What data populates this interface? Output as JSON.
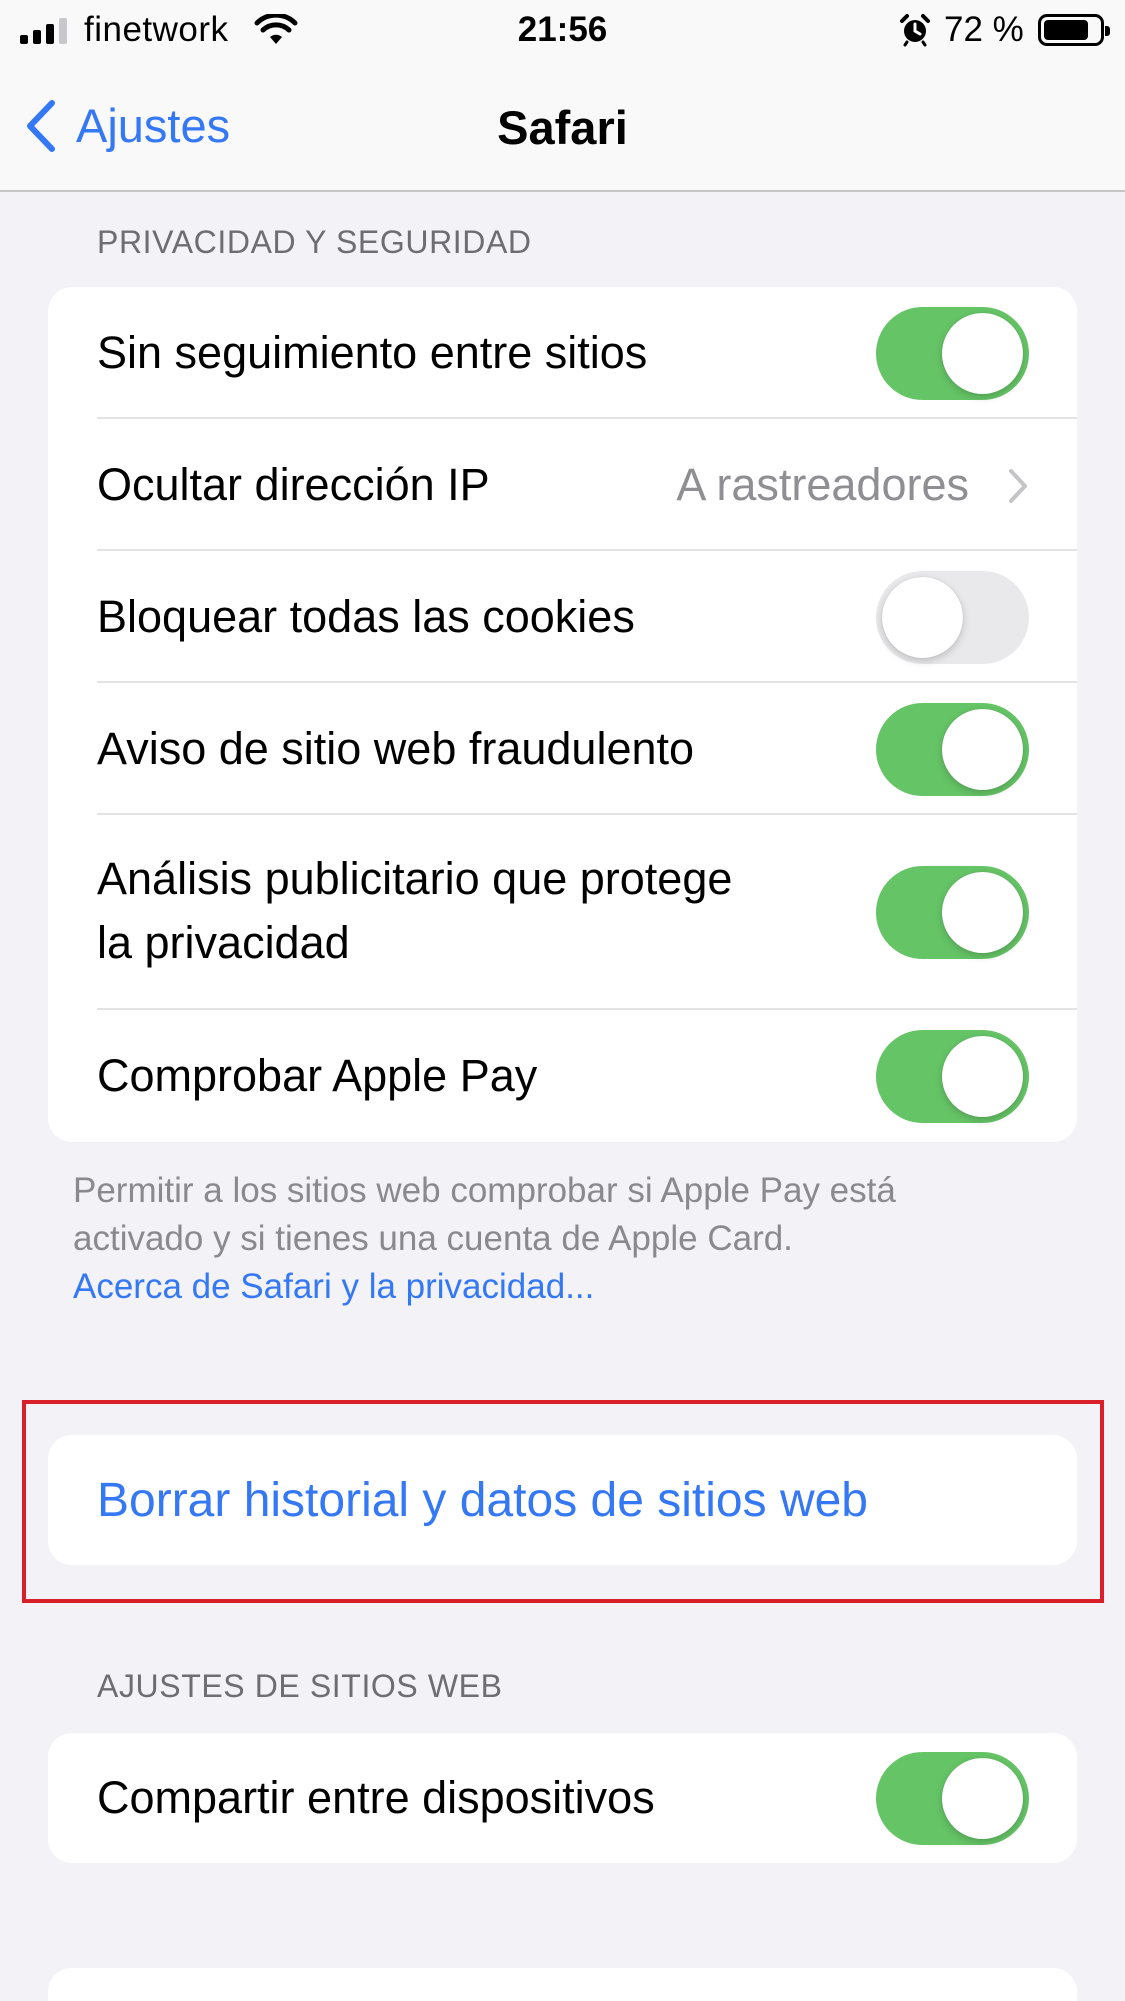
{
  "status_bar": {
    "carrier": "finetwork",
    "time": "21:56",
    "battery_percent": "72 %",
    "battery_level": 0.72,
    "icons": [
      "signal-bars-icon",
      "wifi-icon",
      "alarm-icon",
      "battery-icon"
    ]
  },
  "nav": {
    "back_label": "Ajustes",
    "title": "Safari"
  },
  "privacy_section": {
    "header": "PRIVACIDAD Y SEGURIDAD",
    "rows": [
      {
        "label": "Sin seguimiento entre sitios",
        "control": "toggle",
        "on": true
      },
      {
        "label": "Ocultar dirección IP",
        "control": "disclosure",
        "value": "A rastreadores"
      },
      {
        "label": "Bloquear todas las cookies",
        "control": "toggle",
        "on": false
      },
      {
        "label": "Aviso de sitio web fraudulento",
        "control": "toggle",
        "on": true
      },
      {
        "label_line1": "Análisis publicitario que protege",
        "label_line2": "la privacidad",
        "control": "toggle",
        "on": true
      },
      {
        "label": "Comprobar Apple Pay",
        "control": "toggle",
        "on": true
      }
    ],
    "footer_line1": "Permitir a los sitios web comprobar si Apple Pay está",
    "footer_line2": "activado y si tienes una cuenta de Apple Card.",
    "footer_link": "Acerca de Safari y la privacidad..."
  },
  "clear_history": {
    "label": "Borrar historial y datos de sitios web"
  },
  "website_settings_section": {
    "header": "AJUSTES DE SITIOS WEB",
    "rows": [
      {
        "label": "Compartir entre dispositivos",
        "control": "toggle",
        "on": true
      }
    ]
  },
  "colors": {
    "accent_blue": "#3478f6",
    "toggle_on": "#65c466",
    "toggle_off": "#e9e9eb",
    "highlight_red": "#d9202a",
    "background": "#f2f2f7"
  }
}
